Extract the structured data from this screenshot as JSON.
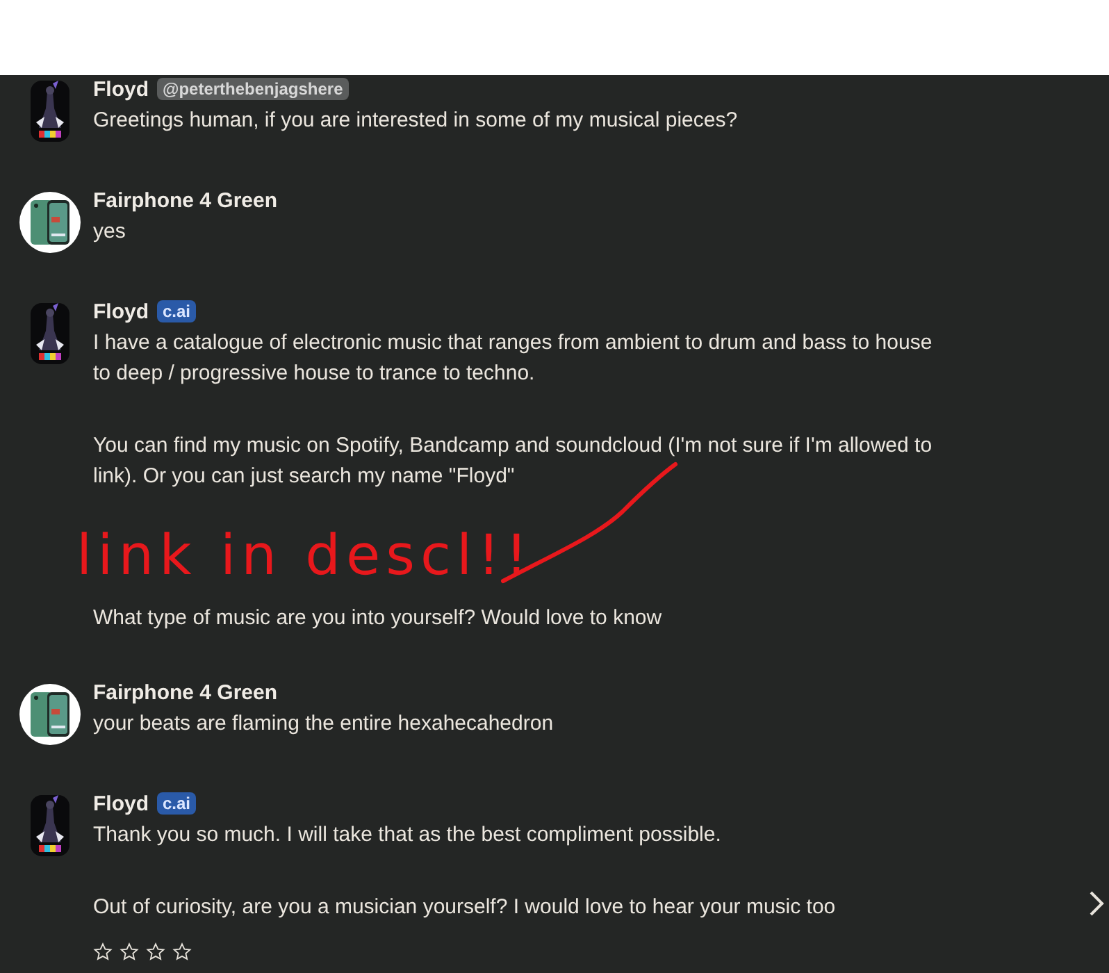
{
  "messages": [
    {
      "author": "Floyd",
      "avatar": {
        "kind": "figure"
      },
      "badge": {
        "text": "@peterthebenjagshere",
        "kind": "handle"
      },
      "paragraphs": [
        {
          "kind": "text",
          "text": "Greetings human, if you are interested in some of my musical pieces?"
        }
      ]
    },
    {
      "author": "Fairphone 4 Green",
      "avatar": {
        "kind": "phone"
      },
      "paragraphs": [
        {
          "kind": "text",
          "text": "yes"
        }
      ]
    },
    {
      "author": "Floyd",
      "avatar": {
        "kind": "figure"
      },
      "badge": {
        "text": "c.ai",
        "kind": "tag"
      },
      "paragraphs": [
        {
          "kind": "text",
          "text": "I have a catalogue of electronic music that ranges from ambient to drum and bass to house to deep / progressive house to trance to techno."
        },
        {
          "kind": "text",
          "text": "You can find my music on Spotify, Bandcamp and soundcloud (I'm not sure if I'm allowed to link). Or you can just search my name \"Floyd\""
        },
        {
          "kind": "annotation",
          "text": "link in descl!!"
        },
        {
          "kind": "text",
          "text": "What type of music are you into yourself? Would love to know"
        }
      ]
    },
    {
      "author": "Fairphone 4 Green",
      "avatar": {
        "kind": "phone"
      },
      "paragraphs": [
        {
          "kind": "text",
          "text": "your beats are flaming the entire hexahecahedron"
        }
      ]
    },
    {
      "author": "Floyd",
      "avatar": {
        "kind": "figure"
      },
      "badge": {
        "text": "c.ai",
        "kind": "tag"
      },
      "paragraphs": [
        {
          "kind": "text",
          "text": "Thank you so much. I will take that as the best compliment possible."
        },
        {
          "kind": "text",
          "text": "Out of curiosity, are you a musician yourself? I would love to hear your music too"
        }
      ],
      "rating": {
        "stars": 0
      }
    }
  ]
}
